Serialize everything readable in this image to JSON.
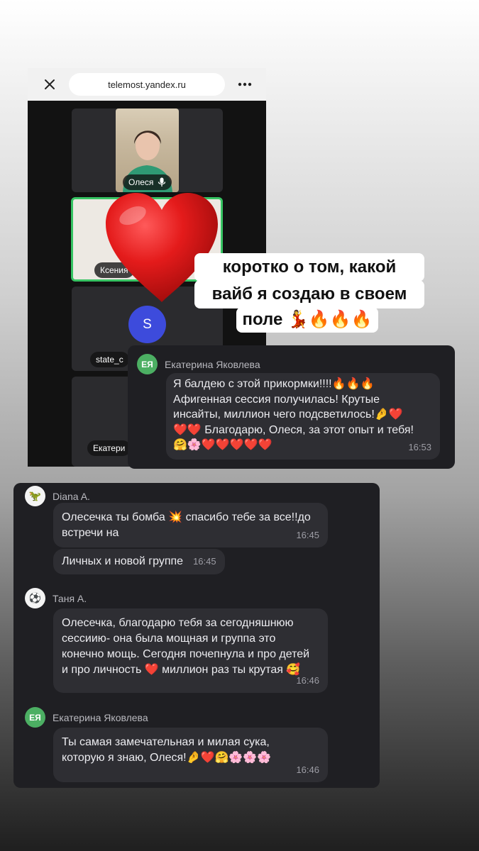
{
  "browser": {
    "url": "telemost.yandex.ru"
  },
  "video_call": {
    "participants": [
      {
        "name": "Олеся",
        "mic": "mic-icon"
      },
      {
        "name": "Ксения"
      },
      {
        "name": "state_c",
        "initial": "S"
      },
      {
        "name": "Екатери"
      }
    ]
  },
  "caption": {
    "lines": [
      "коротко о том, какой",
      "вайб я создаю в своем",
      "поле 💃🔥🔥🔥"
    ]
  },
  "top_chat": {
    "sender": {
      "name": "Екатерина Яковлева",
      "initials": "ЕЯ"
    },
    "message": {
      "text": "Я балдею с этой прикормки!!!!🔥🔥🔥\nАфигенная сессия получилась! Крутые\nинсайты, миллион чего подсветилось!🤌❤️\n❤️❤️ Благодарю, Олеся, за этот опыт и тебя!\n🤗🌸❤️❤️❤️❤️❤️",
      "time": "16:53"
    }
  },
  "chat": {
    "groups": [
      {
        "sender": {
          "name": "Diana A.",
          "avatar": "🦖"
        },
        "messages": [
          {
            "text": "Олесечка ты бомба 💥 спасибо тебе за все!!до\nвстречи на",
            "time": "16:45"
          },
          {
            "text": "Личных и новой группе",
            "time": "16:45"
          }
        ]
      },
      {
        "sender": {
          "name": "Таня А.",
          "avatar": "⚽"
        },
        "messages": [
          {
            "text": "Олесечка, благодарю тебя за сегодняшнюю\nсессиию- она была мощная и группа это\nконечно мощь. Сегодня почепнула и про детей\nи про личность ❤️ миллион раз ты крутая 🥰",
            "time": "16:46"
          }
        ]
      },
      {
        "sender": {
          "name": "Екатерина Яковлева",
          "initials": "ЕЯ"
        },
        "messages": [
          {
            "text": "Ты самая замечательная и милая сука,\nкоторую я знаю, Олеся!🤌❤️🤗🌸🌸🌸",
            "time": "16:46"
          }
        ]
      }
    ]
  }
}
